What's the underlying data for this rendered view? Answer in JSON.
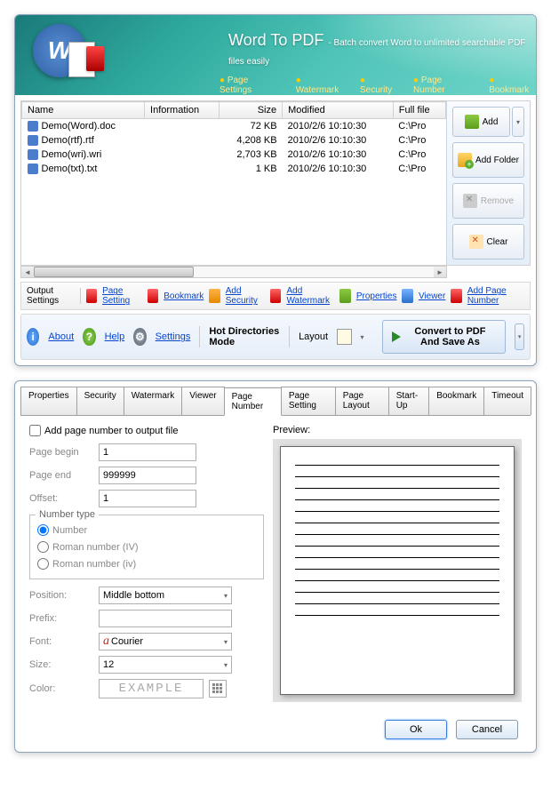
{
  "top_window": {
    "title": "Word To PDF",
    "subtitle": "- Batch convert Word to unlimited searchable PDF files easily",
    "header_links": [
      "Page Settings",
      "Watermark",
      "Security",
      "Page Number",
      "Bookmark"
    ],
    "columns": {
      "name": "Name",
      "information": "Information",
      "size": "Size",
      "modified": "Modified",
      "fullfile": "Full file"
    },
    "files": [
      {
        "name": "Demo(Word).doc",
        "info": "",
        "size": "72 KB",
        "modified": "2010/2/6 10:10:30",
        "full": "C:\\Pro"
      },
      {
        "name": "Demo(rtf).rtf",
        "info": "",
        "size": "4,208 KB",
        "modified": "2010/2/6 10:10:30",
        "full": "C:\\Pro"
      },
      {
        "name": "Demo(wri).wri",
        "info": "",
        "size": "2,703 KB",
        "modified": "2010/2/6 10:10:30",
        "full": "C:\\Pro"
      },
      {
        "name": "Demo(txt).txt",
        "info": "",
        "size": "1 KB",
        "modified": "2010/2/6 10:10:30",
        "full": "C:\\Pro"
      }
    ],
    "actions": {
      "add": "Add",
      "add_folder": "Add Folder",
      "remove": "Remove",
      "clear": "Clear"
    },
    "toolbar": {
      "output_settings": "Output Settings",
      "page_setting": "Page Setting",
      "bookmark": "Bookmark",
      "add_security": "Add Security",
      "add_watermark": "Add Watermark",
      "properties": "Properties",
      "viewer": "Viewer",
      "add_page_number": "Add Page Number"
    },
    "bottom": {
      "about": "About",
      "help": "Help",
      "settings": "Settings",
      "hot_mode": "Hot Directories Mode",
      "layout": "Layout",
      "convert": "Convert to PDF And Save As"
    }
  },
  "lower_window": {
    "tabs": [
      "Properties",
      "Security",
      "Watermark",
      "Viewer",
      "Page Number",
      "Page Setting",
      "Page Layout",
      "Start-Up",
      "Bookmark",
      "Timeout"
    ],
    "active_tab": "Page Number",
    "form": {
      "add_page_number_label": "Add page number to output file",
      "page_begin_label": "Page begin",
      "page_begin_value": "1",
      "page_end_label": "Page end",
      "page_end_value": "999999",
      "offset_label": "Offset:",
      "offset_value": "1",
      "number_type_label": "Number type",
      "radio_number": "Number",
      "radio_roman_upper": "Roman number (IV)",
      "radio_roman_lower": "Roman number (iv)",
      "position_label": "Position:",
      "position_value": "Middle bottom",
      "prefix_label": "Prefix:",
      "prefix_value": "",
      "font_label": "Font:",
      "font_value": "Courier",
      "size_label": "Size:",
      "size_value": "12",
      "color_label": "Color:",
      "color_example": "EXAMPLE"
    },
    "preview_label": "Preview:",
    "buttons": {
      "ok": "Ok",
      "cancel": "Cancel"
    }
  }
}
